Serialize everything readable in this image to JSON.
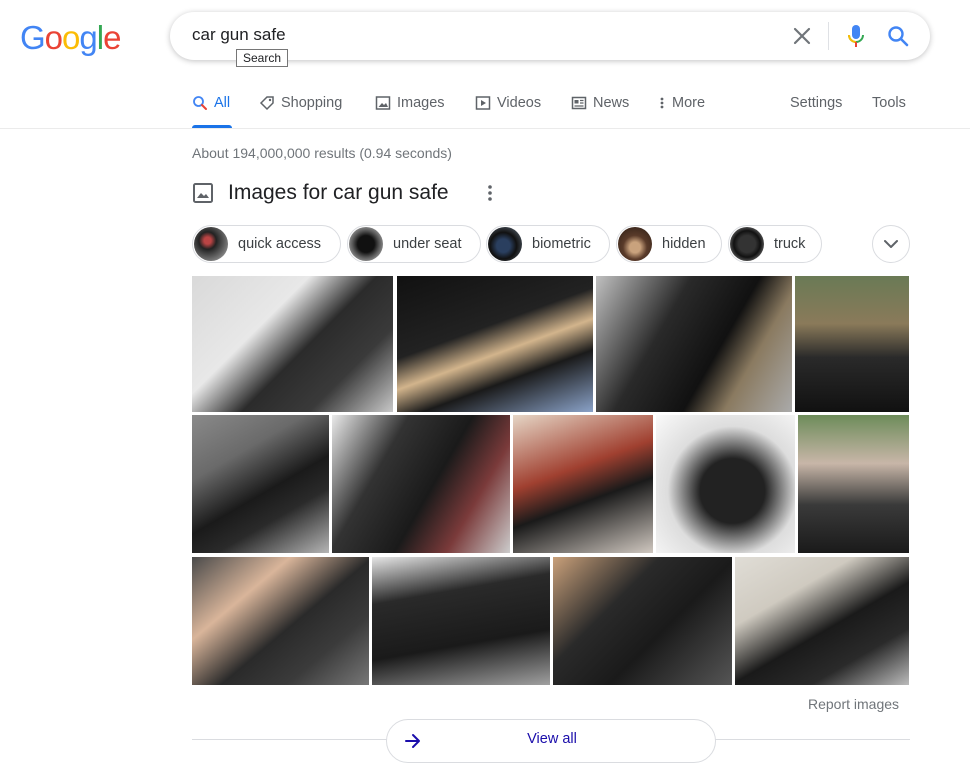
{
  "logo": {
    "letters": [
      "G",
      "o",
      "o",
      "g",
      "l",
      "e"
    ],
    "colors": [
      "#4285F4",
      "#EA4335",
      "#FBBC05",
      "#4285F4",
      "#34A853",
      "#EA4335"
    ]
  },
  "search": {
    "query": "car gun safe",
    "tooltip": "Search"
  },
  "tabs": [
    {
      "label": "All",
      "icon": "search-icon",
      "active": true
    },
    {
      "label": "Shopping",
      "icon": "tag-icon"
    },
    {
      "label": "Images",
      "icon": "image-icon"
    },
    {
      "label": "Videos",
      "icon": "play-icon"
    },
    {
      "label": "News",
      "icon": "newspaper-icon"
    },
    {
      "label": "More",
      "icon": "kebab-icon"
    }
  ],
  "tools": {
    "settings": "Settings",
    "tools": "Tools"
  },
  "stats": "About 194,000,000 results (0.94 seconds)",
  "images_section": {
    "title": "Images for car gun safe",
    "report": "Report images",
    "view_all": "View all"
  },
  "chips": [
    "quick access",
    "under seat",
    "biometric",
    "hidden",
    "truck"
  ],
  "colors": {
    "accent": "#1a73e8",
    "link": "#1a0dab",
    "muted": "#70757a"
  }
}
